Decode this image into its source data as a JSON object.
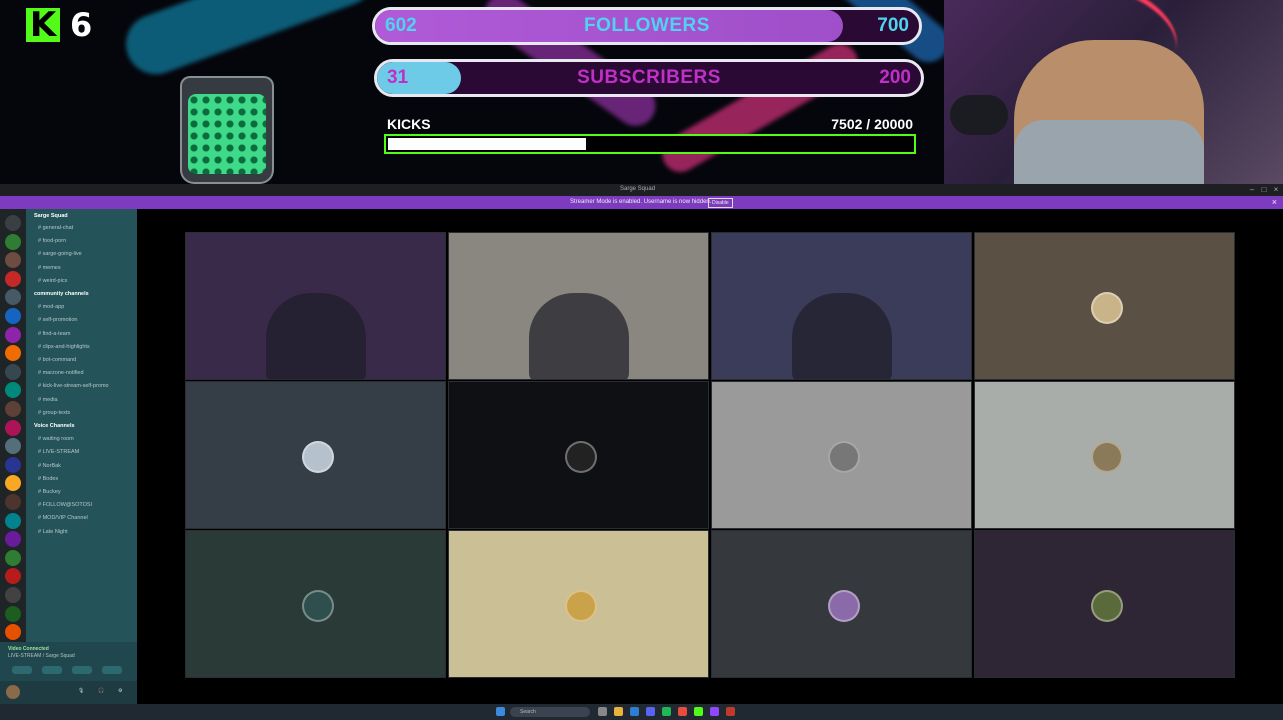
{
  "overlay": {
    "kick_logo": "K",
    "kick_logo_color": "#53fc18",
    "kick_count": "6",
    "followers": {
      "current": "602",
      "label": "FOLLOWERS",
      "goal": "700",
      "progress": 0.86
    },
    "subscribers": {
      "current": "31",
      "label": "SUBSCRIBERS",
      "goal": "200",
      "progress": 0.155
    },
    "kicks": {
      "label": "KICKS",
      "count": "7502  / 20000",
      "progress": 0.375
    }
  },
  "discord": {
    "window_title": "Sarge Squad",
    "banner_text": "Streamer Mode is enabled. Username is now hidden.",
    "banner_button": "Disable",
    "server_name": "Sarge Squad",
    "channels": [
      {
        "label": "general-chat",
        "header": false
      },
      {
        "label": "food-porn",
        "header": false
      },
      {
        "label": "sarge-going-live",
        "header": false
      },
      {
        "label": "memes",
        "header": false
      },
      {
        "label": "weird-pics",
        "header": false
      },
      {
        "label": "community channels",
        "header": true
      },
      {
        "label": "mod-app",
        "header": false
      },
      {
        "label": "self-promotion",
        "header": false
      },
      {
        "label": "find-a-team",
        "header": false
      },
      {
        "label": "clips-and-highlights",
        "header": false
      },
      {
        "label": "bot-command",
        "header": false
      },
      {
        "label": "marzone-notified",
        "header": false
      },
      {
        "label": "kick-live-stream-self-promo",
        "header": false
      },
      {
        "label": "media",
        "header": false
      },
      {
        "label": "group-texts",
        "header": false
      },
      {
        "label": "Voice Channels",
        "header": true
      },
      {
        "label": "waiting room",
        "header": false
      },
      {
        "label": "LIVE-STREAM",
        "header": false
      },
      {
        "label": "NorBak",
        "header": false
      },
      {
        "label": "Bodex",
        "header": false
      },
      {
        "label": "Buckey",
        "header": false
      },
      {
        "label": "FOLLOW@SOTOSI",
        "header": false
      },
      {
        "label": "MOD/VIP Channel",
        "header": false
      },
      {
        "label": "Late Night",
        "header": false
      }
    ],
    "voice_connected": {
      "title": "Video Connected",
      "subtitle": "LIVE-STREAM / Sarge Squad"
    },
    "tiles": [
      {
        "kind": "video",
        "bg": "#3a2a4a"
      },
      {
        "kind": "video",
        "bg": "#8a8680"
      },
      {
        "kind": "video",
        "bg": "#3b3b5a"
      },
      {
        "kind": "avatar",
        "bg": "#5b5044"
      },
      {
        "kind": "avatar",
        "bg": "#353e46"
      },
      {
        "kind": "avatar",
        "bg": "#0f1013"
      },
      {
        "kind": "avatar",
        "bg": "#9a9a9a"
      },
      {
        "kind": "avatar",
        "bg": "#a9adaa"
      },
      {
        "kind": "avatar",
        "bg": "#2a3a36"
      },
      {
        "kind": "avatar",
        "bg": "#cbbf95"
      },
      {
        "kind": "avatar",
        "bg": "#35393d"
      },
      {
        "kind": "avatar",
        "bg": "#2f2635"
      }
    ],
    "taskbar_search": "Search"
  }
}
